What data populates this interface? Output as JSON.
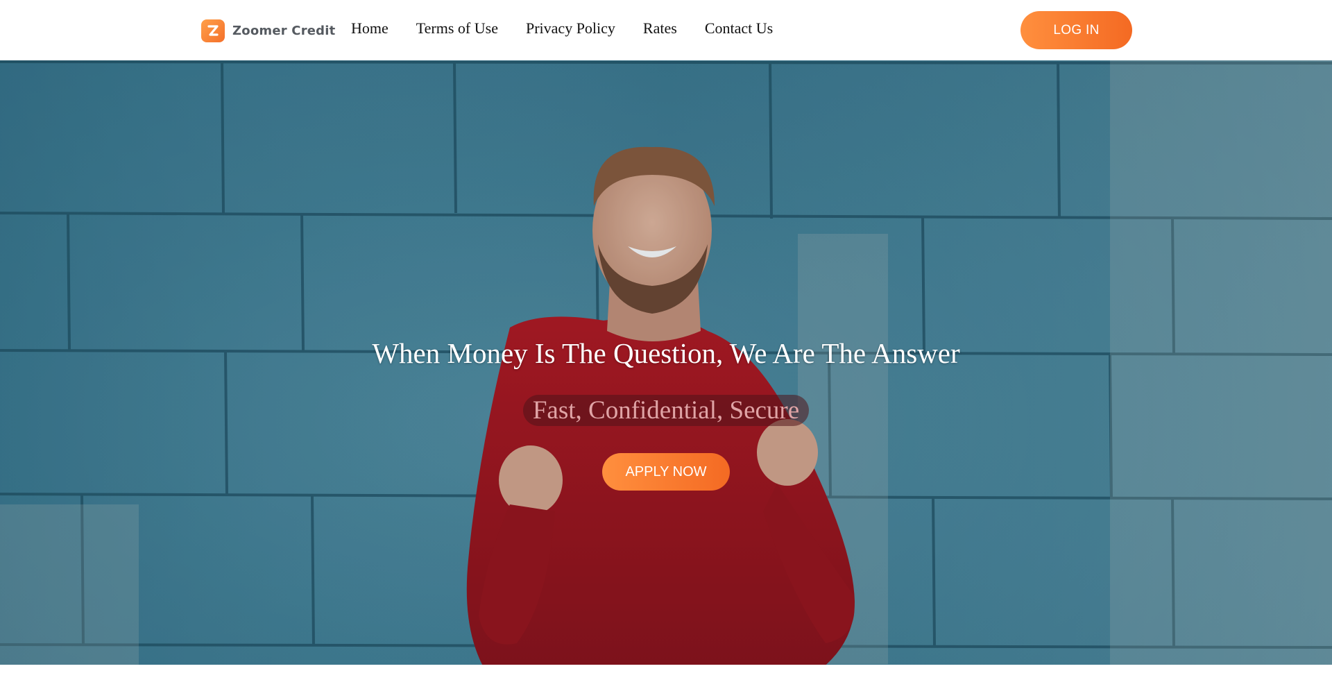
{
  "header": {
    "logo_text": "Zoomer Credit",
    "nav": [
      "Home",
      "Terms of Use",
      "Privacy Policy",
      "Rates",
      "Contact Us"
    ],
    "login_label": "LOG IN"
  },
  "hero": {
    "title": "When Money Is The Question, We Are The Answer",
    "subtitle": "Fast, Confidential, Secure",
    "apply_label": "APPLY NOW"
  },
  "colors": {
    "accent": "#f4702a",
    "accent_light": "#ff8f3e",
    "hero_wall": "#4a8ea5",
    "sweater": "#a8141d"
  }
}
